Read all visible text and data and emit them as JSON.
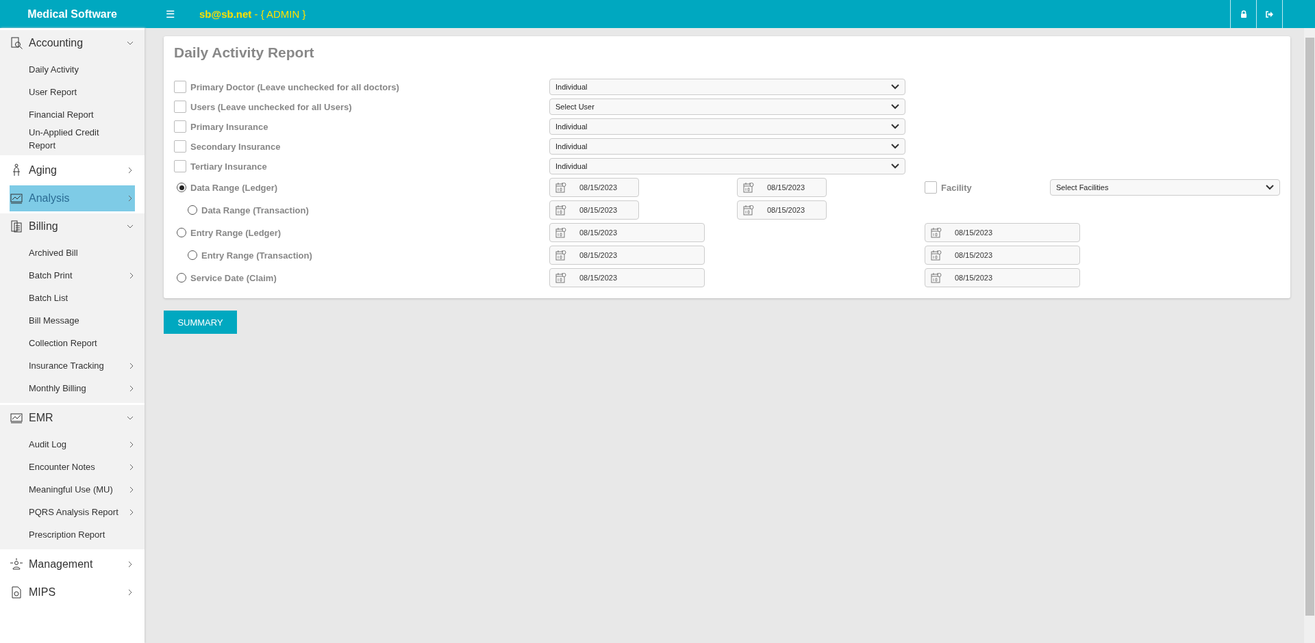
{
  "header": {
    "brand": "Medical Software",
    "menu_glyph": "☰",
    "user": "sb@sb.net",
    "role": " - { ADMIN }"
  },
  "sidebar": [
    {
      "label": "Accounting",
      "expanded": true,
      "selected": false,
      "children": [
        {
          "label": "Daily Activity",
          "has_submenu": false
        },
        {
          "label": "User Report",
          "has_submenu": false
        },
        {
          "label": "Financial Report",
          "has_submenu": false
        },
        {
          "label": "Un-Applied Credit Report",
          "has_submenu": false
        }
      ]
    },
    {
      "label": "Aging",
      "expanded": false,
      "selected": false
    },
    {
      "label": "Analysis",
      "expanded": false,
      "selected": true
    },
    {
      "label": "Billing",
      "expanded": true,
      "selected": false,
      "children": [
        {
          "label": "Archived Bill",
          "has_submenu": false
        },
        {
          "label": "Batch Print",
          "has_submenu": true
        },
        {
          "label": "Batch List",
          "has_submenu": false
        },
        {
          "label": "Bill Message",
          "has_submenu": false
        },
        {
          "label": "Collection Report",
          "has_submenu": false
        },
        {
          "label": "Insurance Tracking",
          "has_submenu": true
        },
        {
          "label": "Monthly Billing",
          "has_submenu": true
        }
      ]
    },
    {
      "label": "EMR",
      "expanded": true,
      "selected": false,
      "children": [
        {
          "label": "Audit Log",
          "has_submenu": true
        },
        {
          "label": "Encounter Notes",
          "has_submenu": true
        },
        {
          "label": "Meaningful Use (MU)",
          "has_submenu": true
        },
        {
          "label": "PQRS Analysis Report",
          "has_submenu": true
        },
        {
          "label": "Prescription Report",
          "has_submenu": false
        }
      ]
    },
    {
      "label": "Management",
      "expanded": false,
      "selected": false
    },
    {
      "label": "MIPS",
      "expanded": false,
      "selected": false
    }
  ],
  "report": {
    "title": "Daily Activity Report",
    "filters": [
      {
        "label": "Primary Doctor (Leave unchecked for all doctors)",
        "checked": false,
        "value": "Individual"
      },
      {
        "label": "Users (Leave unchecked for all Users)",
        "checked": false,
        "value": "Select User"
      },
      {
        "label": "Primary Insurance",
        "checked": false,
        "value": "Individual"
      },
      {
        "label": "Secondary Insurance",
        "checked": false,
        "value": "Individual"
      },
      {
        "label": "Tertiary Insurance",
        "checked": false,
        "value": "Individual"
      }
    ],
    "ranges": [
      {
        "label": "Data Range (Ledger)",
        "selected": true,
        "kind": "compact",
        "dates": [
          "08/15/2023",
          "08/15/2023"
        ],
        "children": [
          {
            "label": "Data Range (Transaction)",
            "selected": false,
            "kind": "compact",
            "dates": [
              "08/15/2023",
              "08/15/2023"
            ]
          }
        ]
      },
      {
        "label": "Entry Range (Ledger)",
        "selected": false,
        "kind": "wide",
        "dates": [
          "08/15/2023",
          "08/15/2023"
        ],
        "children": [
          {
            "label": "Entry Range (Transaction)",
            "selected": false,
            "kind": "wide",
            "dates": [
              "08/15/2023",
              "08/15/2023"
            ]
          }
        ]
      },
      {
        "label": "Service Date (Claim)",
        "selected": false,
        "kind": "wide",
        "dates": [
          "08/15/2023",
          "08/15/2023"
        ]
      }
    ],
    "facility": {
      "label": "Facility",
      "checked": false,
      "value": "Select Facilities"
    },
    "summary_button": "SUMMARY"
  }
}
